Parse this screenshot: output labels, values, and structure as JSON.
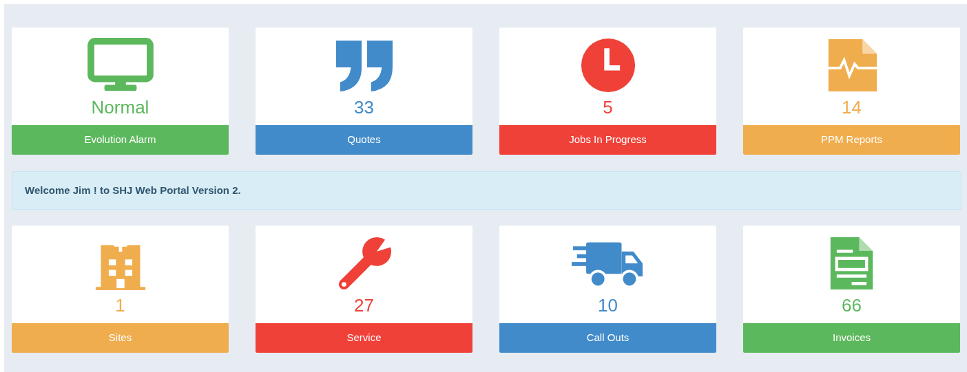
{
  "tiles_top": [
    {
      "kind": "monitor",
      "value": "Normal",
      "label": "Evolution Alarm",
      "color": "#5cb85c"
    },
    {
      "kind": "quote",
      "value": "33",
      "label": "Quotes",
      "color": "#428bca"
    },
    {
      "kind": "clock",
      "value": "5",
      "label": "Jobs In Progress",
      "color": "#ef4138"
    },
    {
      "kind": "file-pulse",
      "value": "14",
      "label": "PPM Reports",
      "color": "#f0ad4e"
    }
  ],
  "alert": {
    "text": "Welcome Jim ! to SHJ Web Portal Version 2."
  },
  "tiles_bottom": [
    {
      "kind": "building",
      "value": "1",
      "label": "Sites",
      "color": "#f0ad4e"
    },
    {
      "kind": "wrench",
      "value": "27",
      "label": "Service",
      "color": "#ef4138"
    },
    {
      "kind": "truck",
      "value": "10",
      "label": "Call Outs",
      "color": "#428bca"
    },
    {
      "kind": "invoice",
      "value": "66",
      "label": "Invoices",
      "color": "#5cb85c"
    }
  ]
}
